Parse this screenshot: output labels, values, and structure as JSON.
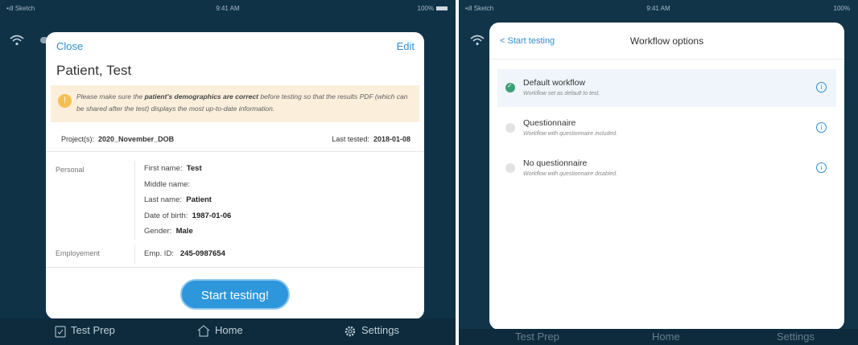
{
  "left": {
    "statusbar": {
      "signal": "•ıll Sketch",
      "time": "9:41 AM",
      "battery": "100%"
    },
    "modal": {
      "close_label": "Close",
      "edit_label": "Edit",
      "title": "Patient, Test",
      "warning": {
        "before": "Please make sure the ",
        "bold": "patient's demographics are correct",
        "after": " before testing so that the results PDF (which can be shared after the test) displays the most up-to-date information."
      },
      "projects_label": "Project(s):",
      "projects_value": "2020_November_DOB",
      "last_tested_label": "Last tested:",
      "last_tested_value": "2018-01-08",
      "personal_label": "Personal",
      "fields": [
        {
          "label": "First name:",
          "value": "Test"
        },
        {
          "label": "Middle name:",
          "value": ""
        },
        {
          "label": "Last name:",
          "value": "Patient"
        },
        {
          "label": "Date of birth:",
          "value": "1987-01-06"
        },
        {
          "label": "Gender:",
          "value": "Male"
        }
      ],
      "employment_label": "Employement",
      "emp_id_label": "Emp. ID:",
      "emp_id_value": "245-0987654",
      "start_button": "Start testing!"
    },
    "tabs": [
      {
        "icon": "clipboard-check-icon",
        "label": "Test Prep"
      },
      {
        "icon": "home-icon",
        "label": "Home"
      },
      {
        "icon": "gear-icon",
        "label": "Settings"
      }
    ]
  },
  "right": {
    "statusbar": {
      "signal": "•ıll Sketch",
      "time": "9:41 AM",
      "battery": "100%"
    },
    "back_label": "< Start testing",
    "title": "Workflow options",
    "options": [
      {
        "name": "Default workflow",
        "desc": "Workflow set as default to test.",
        "selected": true
      },
      {
        "name": "Questionnaire",
        "desc": "Workflow with questionnaire included.",
        "selected": false
      },
      {
        "name": "No questionnaire",
        "desc": "Workflow with questionnaire disabled.",
        "selected": false
      }
    ],
    "tabs": [
      {
        "label": "Test Prep"
      },
      {
        "label": "Home"
      },
      {
        "label": "Settings"
      }
    ]
  },
  "colors": {
    "accent": "#2f8fd0",
    "background": "#0f3247",
    "warning": "#fbefdc",
    "selected_radio": "#3aa176"
  }
}
